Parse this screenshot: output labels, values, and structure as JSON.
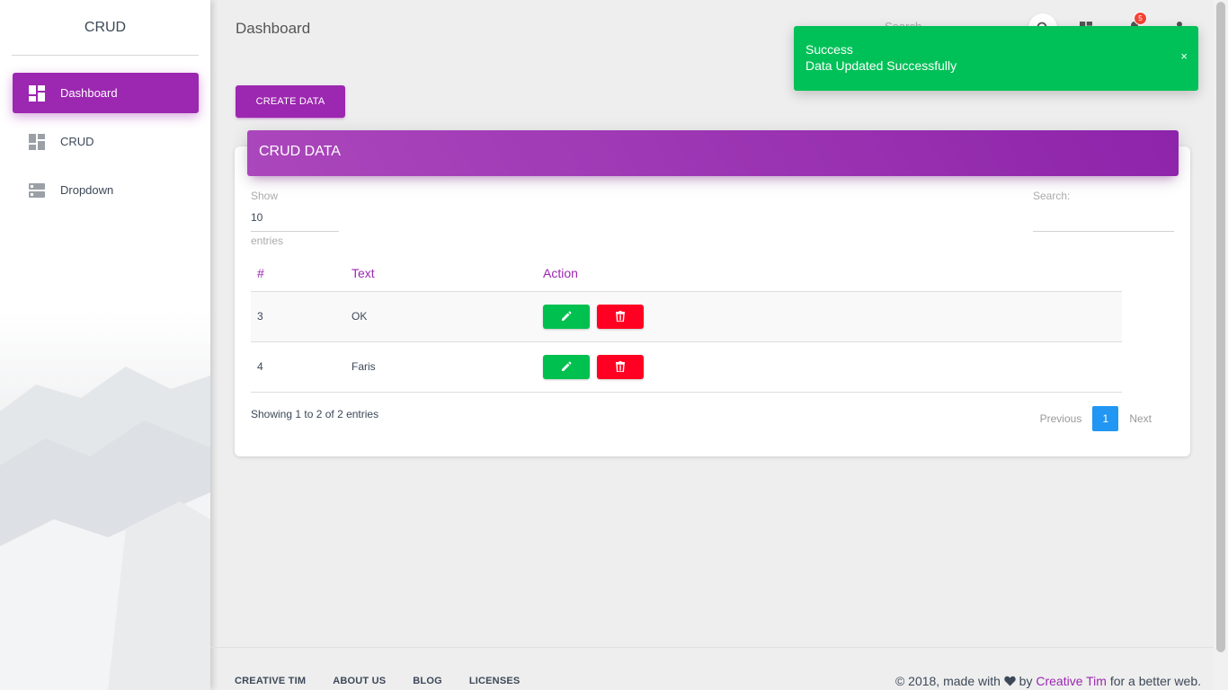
{
  "sidebar": {
    "brand": "CRUD",
    "items": [
      {
        "label": "Dashboard",
        "icon": "dashboard-icon",
        "active": true
      },
      {
        "label": "CRUD",
        "icon": "dashboard-icon",
        "active": false
      },
      {
        "label": "Dropdown",
        "icon": "storage-icon",
        "active": false
      }
    ]
  },
  "topbar": {
    "title": "Dashboard",
    "search_placeholder": "Search",
    "notification_count": "5"
  },
  "toolbar": {
    "create_label": "CREATE DATA"
  },
  "card": {
    "title": "CRUD DATA",
    "show_label": "Show",
    "length_value": "10",
    "entries_label": "entries",
    "search_label": "Search:",
    "columns": [
      "#",
      "Text",
      "Action"
    ],
    "rows": [
      {
        "id": "3",
        "text": "OK"
      },
      {
        "id": "4",
        "text": "Faris"
      }
    ],
    "info": "Showing 1 to 2 of 2 entries",
    "pagination": {
      "previous": "Previous",
      "current": "1",
      "next": "Next"
    }
  },
  "toast": {
    "title": "Success",
    "message": "Data Updated Successfully",
    "close": "×"
  },
  "footer": {
    "links": [
      "CREATIVE TIM",
      "ABOUT US",
      "BLOG",
      "LICENSES"
    ],
    "copyright_prefix": "© 2018, made with",
    "copyright_by": "by",
    "copyright_link": "Creative Tim",
    "copyright_suffix": "for a better web."
  },
  "colors": {
    "primary": "#9c27b0",
    "success": "#00c157",
    "danger": "#ff0022",
    "info": "#2196f3"
  }
}
